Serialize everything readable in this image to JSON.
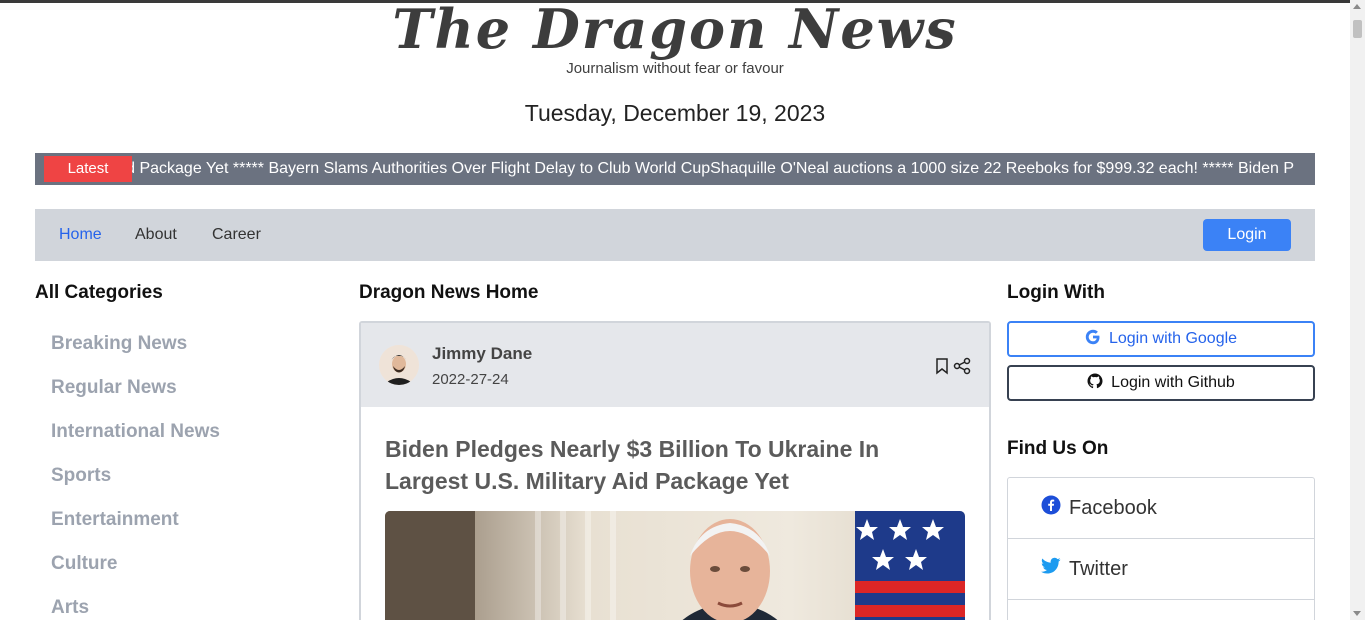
{
  "site": {
    "logo_text": "The Dragon News",
    "tagline": "Journalism without fear or favour",
    "date": "Tuesday, December 19, 2023"
  },
  "ticker": {
    "badge": "Latest",
    "text": "ry Aid Package Yet ***** Bayern Slams Authorities Over Flight Delay to Club World CupShaquille O'Neal auctions a 1000 size 22 Reeboks for $999.32 each! ***** Biden P"
  },
  "nav": {
    "links": [
      "Home",
      "About",
      "Career"
    ],
    "active": "Home",
    "login_label": "Login"
  },
  "left": {
    "title": "All Categories",
    "categories": [
      "Breaking News",
      "Regular News",
      "International News",
      "Sports",
      "Entertainment",
      "Culture",
      "Arts"
    ]
  },
  "main": {
    "title": "Dragon News Home",
    "article": {
      "author": "Jimmy Dane",
      "date": "2022-27-24",
      "headline": "Biden Pledges Nearly $3 Billion To Ukraine In Largest U.S. Military Aid Package Yet"
    }
  },
  "right": {
    "login_title": "Login With",
    "google_label": "Login with Google",
    "github_label": "Login with Github",
    "find_title": "Find Us On",
    "social": [
      "Facebook",
      "Twitter"
    ]
  },
  "colors": {
    "accent": "#3b82f6",
    "badge": "#ef4444",
    "ticker_bg": "#6b7280",
    "nav_bg": "#d1d5db"
  },
  "icons": [
    "bookmark-icon",
    "share-icon",
    "google-icon",
    "github-icon",
    "facebook-icon",
    "twitter-icon"
  ]
}
